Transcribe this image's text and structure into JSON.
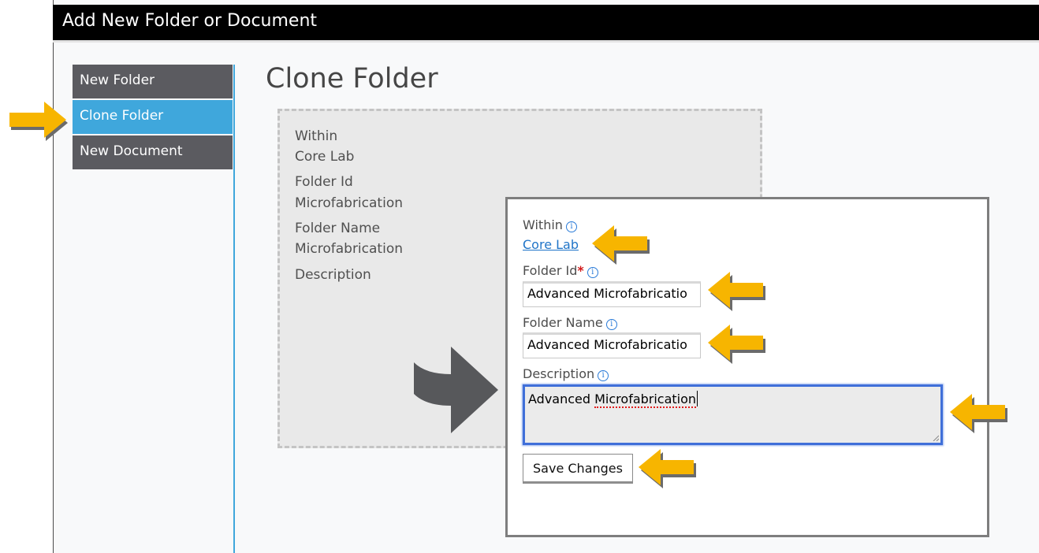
{
  "window": {
    "title": "Add New Folder or Document"
  },
  "sidebar": {
    "items": [
      {
        "label": "New Folder"
      },
      {
        "label": "Clone Folder"
      },
      {
        "label": "New Document"
      }
    ]
  },
  "main": {
    "heading": "Clone Folder",
    "summary": {
      "within_label": "Within",
      "within_value": "Core Lab",
      "folder_id_label": "Folder Id",
      "folder_id_value": "Microfabrication",
      "folder_name_label": "Folder Name",
      "folder_name_value": "Microfabrication",
      "description_label": "Description"
    }
  },
  "form": {
    "within_label": "Within",
    "within_link": "Core Lab",
    "folder_id_label": "Folder Id",
    "required_marker": "*",
    "folder_id_value": "Advanced Microfabricatio",
    "folder_name_label": "Folder Name",
    "folder_name_value": "Advanced Microfabricatio",
    "description_label": "Description",
    "description_word1": "Advanced",
    "description_word2": "Microfabrication",
    "save_button": "Save Changes"
  },
  "info_glyph": "i",
  "colors": {
    "accent": "#3fa7dc",
    "nav_bg": "#5b5b60",
    "callout_arrow": "#f7b500",
    "link": "#1f74c8",
    "focus_border": "#3f6fd9"
  },
  "icons": {
    "callout": "yellow-arrow-icon",
    "transition": "big-gray-arrow-icon",
    "info": "info-circle-icon"
  }
}
